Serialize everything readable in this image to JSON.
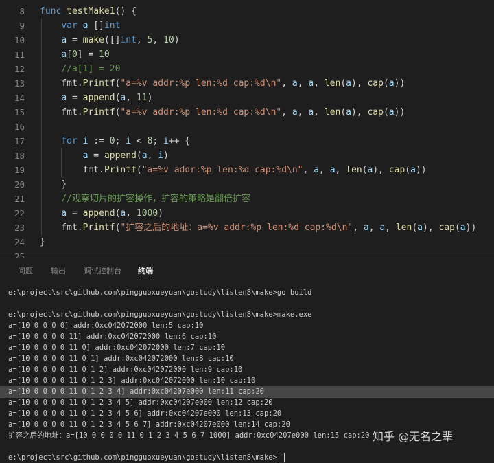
{
  "editor": {
    "lines": [
      {
        "n": "8",
        "tokens": [
          [
            "func ",
            "kw"
          ],
          [
            "testMake1",
            "fn"
          ],
          [
            "() {",
            "p"
          ]
        ]
      },
      {
        "n": "9",
        "tokens": [
          [
            "    ",
            "p"
          ],
          [
            "var ",
            "kw"
          ],
          [
            "a ",
            "v"
          ],
          [
            "[]",
            "p"
          ],
          [
            "int",
            "kw"
          ]
        ]
      },
      {
        "n": "10",
        "tokens": [
          [
            "    ",
            "p"
          ],
          [
            "a",
            "v"
          ],
          [
            " = ",
            "p"
          ],
          [
            "make",
            "fn"
          ],
          [
            "([]",
            "p"
          ],
          [
            "int",
            "kw"
          ],
          [
            ", ",
            "p"
          ],
          [
            "5",
            "num"
          ],
          [
            ", ",
            "p"
          ],
          [
            "10",
            "num"
          ],
          [
            ")",
            "p"
          ]
        ]
      },
      {
        "n": "11",
        "tokens": [
          [
            "    ",
            "p"
          ],
          [
            "a",
            "v"
          ],
          [
            "[",
            "p"
          ],
          [
            "0",
            "num"
          ],
          [
            "] = ",
            "p"
          ],
          [
            "10",
            "num"
          ]
        ]
      },
      {
        "n": "12",
        "tokens": [
          [
            "    ",
            "p"
          ],
          [
            "//a[1] = 20",
            "cm"
          ]
        ]
      },
      {
        "n": "13",
        "tokens": [
          [
            "    ",
            "p"
          ],
          [
            "fmt",
            "p"
          ],
          [
            ".",
            "p"
          ],
          [
            "Printf",
            "fn"
          ],
          [
            "(",
            "p"
          ],
          [
            "\"a=%v addr:%p len:%d cap:%d\\n\"",
            "str"
          ],
          [
            ", ",
            "p"
          ],
          [
            "a",
            "v"
          ],
          [
            ", ",
            "p"
          ],
          [
            "a",
            "v"
          ],
          [
            ", ",
            "p"
          ],
          [
            "len",
            "fn"
          ],
          [
            "(",
            "p"
          ],
          [
            "a",
            "v"
          ],
          [
            "), ",
            "p"
          ],
          [
            "cap",
            "fn"
          ],
          [
            "(",
            "p"
          ],
          [
            "a",
            "v"
          ],
          [
            "))",
            "p"
          ]
        ]
      },
      {
        "n": "14",
        "tokens": [
          [
            "    ",
            "p"
          ],
          [
            "a",
            "v"
          ],
          [
            " = ",
            "p"
          ],
          [
            "append",
            "fn"
          ],
          [
            "(",
            "p"
          ],
          [
            "a",
            "v"
          ],
          [
            ", ",
            "p"
          ],
          [
            "11",
            "num"
          ],
          [
            ")",
            "p"
          ]
        ]
      },
      {
        "n": "15",
        "tokens": [
          [
            "    ",
            "p"
          ],
          [
            "fmt",
            "p"
          ],
          [
            ".",
            "p"
          ],
          [
            "Printf",
            "fn"
          ],
          [
            "(",
            "p"
          ],
          [
            "\"a=%v addr:%p len:%d cap:%d\\n\"",
            "str"
          ],
          [
            ", ",
            "p"
          ],
          [
            "a",
            "v"
          ],
          [
            ", ",
            "p"
          ],
          [
            "a",
            "v"
          ],
          [
            ", ",
            "p"
          ],
          [
            "len",
            "fn"
          ],
          [
            "(",
            "p"
          ],
          [
            "a",
            "v"
          ],
          [
            "), ",
            "p"
          ],
          [
            "cap",
            "fn"
          ],
          [
            "(",
            "p"
          ],
          [
            "a",
            "v"
          ],
          [
            "))",
            "p"
          ]
        ]
      },
      {
        "n": "16",
        "tokens": []
      },
      {
        "n": "17",
        "tokens": [
          [
            "    ",
            "p"
          ],
          [
            "for ",
            "kw"
          ],
          [
            "i",
            "v"
          ],
          [
            " := ",
            "p"
          ],
          [
            "0",
            "num"
          ],
          [
            "; ",
            "p"
          ],
          [
            "i",
            "v"
          ],
          [
            " < ",
            "p"
          ],
          [
            "8",
            "num"
          ],
          [
            "; ",
            "p"
          ],
          [
            "i",
            "v"
          ],
          [
            "++ {",
            "p"
          ]
        ]
      },
      {
        "n": "18",
        "tokens": [
          [
            "        ",
            "p"
          ],
          [
            "a",
            "v"
          ],
          [
            " = ",
            "p"
          ],
          [
            "append",
            "fn"
          ],
          [
            "(",
            "p"
          ],
          [
            "a",
            "v"
          ],
          [
            ", ",
            "p"
          ],
          [
            "i",
            "v"
          ],
          [
            ")",
            "p"
          ]
        ]
      },
      {
        "n": "19",
        "tokens": [
          [
            "        ",
            "p"
          ],
          [
            "fmt",
            "p"
          ],
          [
            ".",
            "p"
          ],
          [
            "Printf",
            "fn"
          ],
          [
            "(",
            "p"
          ],
          [
            "\"a=%v addr:%p len:%d cap:%d\\n\"",
            "str"
          ],
          [
            ", ",
            "p"
          ],
          [
            "a",
            "v"
          ],
          [
            ", ",
            "p"
          ],
          [
            "a",
            "v"
          ],
          [
            ", ",
            "p"
          ],
          [
            "len",
            "fn"
          ],
          [
            "(",
            "p"
          ],
          [
            "a",
            "v"
          ],
          [
            "), ",
            "p"
          ],
          [
            "cap",
            "fn"
          ],
          [
            "(",
            "p"
          ],
          [
            "a",
            "v"
          ],
          [
            "))",
            "p"
          ]
        ]
      },
      {
        "n": "20",
        "tokens": [
          [
            "    ",
            "p"
          ],
          [
            "}",
            "p"
          ]
        ]
      },
      {
        "n": "21",
        "tokens": [
          [
            "    ",
            "p"
          ],
          [
            "//观察切片的扩容操作，扩容的策略是翻倍扩容",
            "cm"
          ]
        ]
      },
      {
        "n": "22",
        "tokens": [
          [
            "    ",
            "p"
          ],
          [
            "a",
            "v"
          ],
          [
            " = ",
            "p"
          ],
          [
            "append",
            "fn"
          ],
          [
            "(",
            "p"
          ],
          [
            "a",
            "v"
          ],
          [
            ", ",
            "p"
          ],
          [
            "1000",
            "num"
          ],
          [
            ")",
            "p"
          ]
        ]
      },
      {
        "n": "23",
        "tokens": [
          [
            "    ",
            "p"
          ],
          [
            "fmt",
            "p"
          ],
          [
            ".",
            "p"
          ],
          [
            "Printf",
            "fn"
          ],
          [
            "(",
            "p"
          ],
          [
            "\"扩容之后的地址：a=%v addr:%p len:%d cap:%d\\n\"",
            "str"
          ],
          [
            ", ",
            "p"
          ],
          [
            "a",
            "v"
          ],
          [
            ", ",
            "p"
          ],
          [
            "a",
            "v"
          ],
          [
            ", ",
            "p"
          ],
          [
            "len",
            "fn"
          ],
          [
            "(",
            "p"
          ],
          [
            "a",
            "v"
          ],
          [
            "), ",
            "p"
          ],
          [
            "cap",
            "fn"
          ],
          [
            "(",
            "p"
          ],
          [
            "a",
            "v"
          ],
          [
            "))",
            "p"
          ]
        ]
      },
      {
        "n": "24",
        "tokens": [
          [
            "}",
            "p"
          ]
        ]
      },
      {
        "n": "25",
        "tokens": []
      }
    ]
  },
  "panel": {
    "tabs": [
      {
        "label": "问题",
        "active": false
      },
      {
        "label": "输出",
        "active": false
      },
      {
        "label": "调试控制台",
        "active": false
      },
      {
        "label": "终端",
        "active": true
      }
    ],
    "terminal": [
      "e:\\project\\src\\github.com\\pingguoxueyuan\\gostudy\\listen8\\make>go build",
      "",
      "e:\\project\\src\\github.com\\pingguoxueyuan\\gostudy\\listen8\\make>make.exe",
      "a=[10 0 0 0 0] addr:0xc042072000 len:5 cap:10",
      "a=[10 0 0 0 0 11] addr:0xc042072000 len:6 cap:10",
      "a=[10 0 0 0 0 11 0] addr:0xc042072000 len:7 cap:10",
      "a=[10 0 0 0 0 11 0 1] addr:0xc042072000 len:8 cap:10",
      "a=[10 0 0 0 0 11 0 1 2] addr:0xc042072000 len:9 cap:10",
      "a=[10 0 0 0 0 11 0 1 2 3] addr:0xc042072000 len:10 cap:10",
      "a=[10 0 0 0 0 11 0 1 2 3 4] addr:0xc04207e000 len:11 cap:20",
      "a=[10 0 0 0 0 11 0 1 2 3 4 5] addr:0xc04207e000 len:12 cap:20",
      "a=[10 0 0 0 0 11 0 1 2 3 4 5 6] addr:0xc04207e000 len:13 cap:20",
      "a=[10 0 0 0 0 11 0 1 2 3 4 5 6 7] addr:0xc04207e000 len:14 cap:20",
      "扩容之后的地址：a=[10 0 0 0 0 11 0 1 2 3 4 5 6 7 1000] addr:0xc04207e000 len:15 cap:20",
      "",
      "e:\\project\\src\\github.com\\pingguoxueyuan\\gostudy\\listen8\\make>"
    ],
    "highlighted_line": 9
  },
  "watermark": "知乎 @无名之辈",
  "colors": {
    "kw": "#569cd6",
    "fn": "#dcdcaa",
    "str": "#ce9178",
    "num": "#b5cea8",
    "cm": "#6a9955",
    "v": "#9cdcfe",
    "p": "#d4d4d4"
  }
}
